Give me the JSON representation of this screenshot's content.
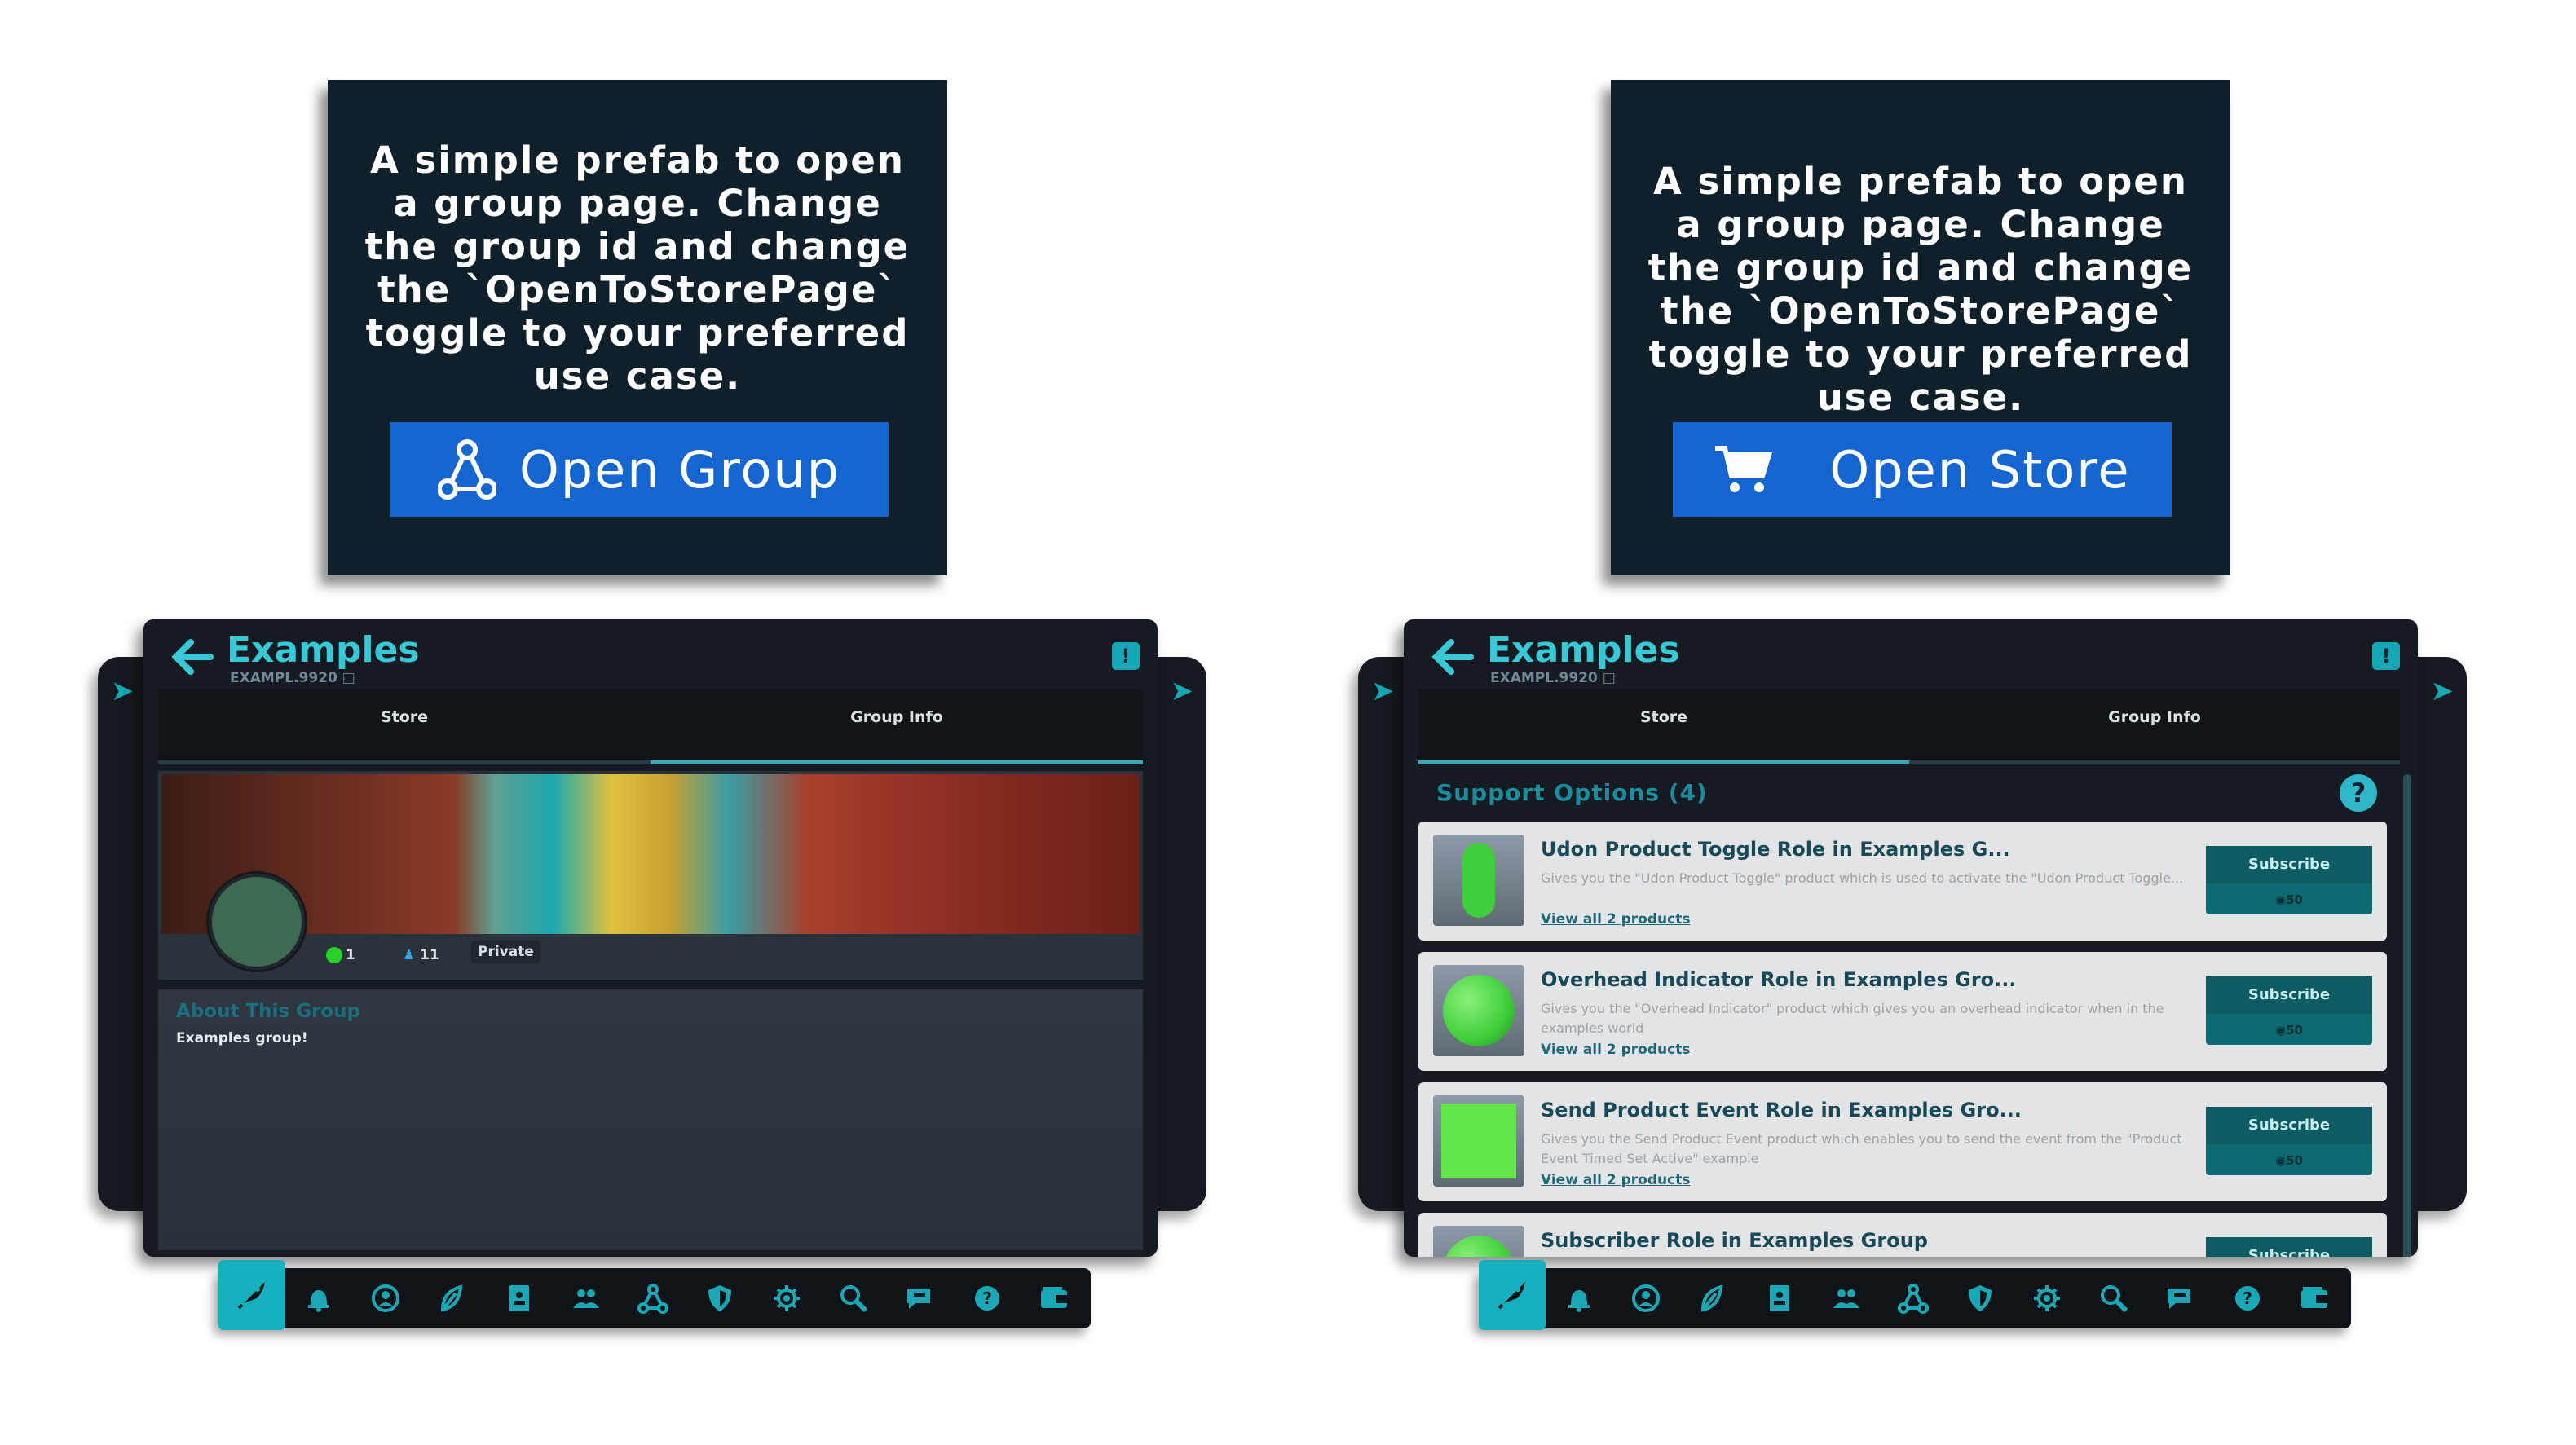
{
  "left_panel": {
    "description": "A simple prefab to open a group page. Change the group id and change the `OpenToStorePage` toggle to your preferred use case.",
    "button_label": "Open Group",
    "button_icon": "group-network-icon"
  },
  "right_panel": {
    "description": "A simple prefab to open a group page. Change the group id and change the `OpenToStorePage` toggle to your preferred use case.",
    "button_label": "Open Store",
    "button_icon": "shopping-cart-icon"
  },
  "left_menu": {
    "title": "Examples",
    "group_code": "EXAMPL.9920",
    "tabs": [
      "Store",
      "Group Info"
    ],
    "active_tab": "Group Info",
    "online_count": "1",
    "member_count": "11",
    "privacy": "Private",
    "about_heading": "About This Group",
    "about_text": "Examples group!"
  },
  "right_menu": {
    "title": "Examples",
    "group_code": "EXAMPL.9920",
    "tabs": [
      "Store",
      "Group Info"
    ],
    "active_tab": "Store",
    "support_heading": "Support Options (4)",
    "help_label": "?",
    "products": [
      {
        "title": "Udon Product Toggle Role in Examples G...",
        "description": "Gives you the \"Udon Product Toggle\" product which is used to activate the \"Udon Product Toggle...",
        "link": "View all 2 products",
        "button": "Subscribe",
        "price": "50",
        "thumb_color": "#3fcf3a",
        "thumb_shape": "capsule"
      },
      {
        "title": "Overhead Indicator Role in Examples Gro...",
        "description": "Gives you the \"Overhead Indicator\" product which gives you an overhead indicator when in the examples world",
        "link": "View all 2 products",
        "button": "Subscribe",
        "price": "50",
        "thumb_color": "#3fcf3a",
        "thumb_shape": "sphere"
      },
      {
        "title": "Send Product Event Role in Examples Gro...",
        "description": "Gives you the Send Product Event product which enables you to send the event from the \"Product Event Timed Set Active\" example",
        "link": "View all 2 products",
        "button": "Subscribe",
        "price": "50",
        "thumb_color": "#62e64a",
        "thumb_shape": "cube"
      },
      {
        "title": "Subscriber Role in Examples Group",
        "description": "",
        "link": "",
        "button": "Subscribe",
        "price": "",
        "thumb_color": "#3fcf3a",
        "thumb_shape": "sphere"
      }
    ]
  },
  "dock_icons": [
    "rocket-icon",
    "bell-icon",
    "user-circle-icon",
    "compass-icon",
    "contacts-book-icon",
    "group-people-icon",
    "group-network-icon",
    "shield-icon",
    "gear-icon",
    "search-icon",
    "chat-icon",
    "help-icon",
    "wallet-icon"
  ],
  "colors": {
    "accent": "#16b0bf",
    "panel_bg": "#10202a",
    "button_blue": "#1565d0"
  }
}
